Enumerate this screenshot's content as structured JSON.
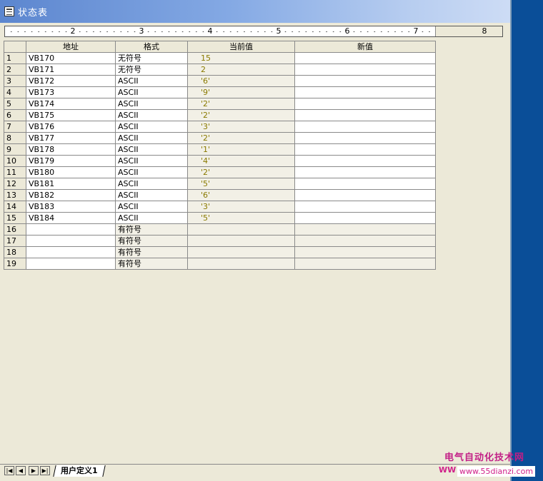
{
  "window": {
    "title": "状态表"
  },
  "ruler": {
    "labels": [
      "2",
      "3",
      "4",
      "5",
      "6",
      "7",
      "8"
    ]
  },
  "table": {
    "headers": {
      "address": "地址",
      "format": "格式",
      "current": "当前值",
      "new": "新值"
    },
    "rows": [
      {
        "num": "1",
        "address": "VB170",
        "format": "无符号",
        "current": "15"
      },
      {
        "num": "2",
        "address": "VB171",
        "format": "无符号",
        "current": "2"
      },
      {
        "num": "3",
        "address": "VB172",
        "format": "ASCII",
        "current": "'6'"
      },
      {
        "num": "4",
        "address": "VB173",
        "format": "ASCII",
        "current": "'9'"
      },
      {
        "num": "5",
        "address": "VB174",
        "format": "ASCII",
        "current": "'2'"
      },
      {
        "num": "6",
        "address": "VB175",
        "format": "ASCII",
        "current": "'2'"
      },
      {
        "num": "7",
        "address": "VB176",
        "format": "ASCII",
        "current": "'3'"
      },
      {
        "num": "8",
        "address": "VB177",
        "format": "ASCII",
        "current": "'2'"
      },
      {
        "num": "9",
        "address": "VB178",
        "format": "ASCII",
        "current": "'1'"
      },
      {
        "num": "10",
        "address": "VB179",
        "format": "ASCII",
        "current": "'4'"
      },
      {
        "num": "11",
        "address": "VB180",
        "format": "ASCII",
        "current": "'2'"
      },
      {
        "num": "12",
        "address": "VB181",
        "format": "ASCII",
        "current": "'5'"
      },
      {
        "num": "13",
        "address": "VB182",
        "format": "ASCII",
        "current": "'6'"
      },
      {
        "num": "14",
        "address": "VB183",
        "format": "ASCII",
        "current": "'3'"
      },
      {
        "num": "15",
        "address": "VB184",
        "format": "ASCII",
        "current": "'5'"
      },
      {
        "num": "16",
        "address": "",
        "format": "有符号",
        "current": ""
      },
      {
        "num": "17",
        "address": "",
        "format": "有符号",
        "current": ""
      },
      {
        "num": "18",
        "address": "",
        "format": "有符号",
        "current": ""
      },
      {
        "num": "19",
        "address": "",
        "format": "有符号",
        "current": ""
      }
    ]
  },
  "sheet_tab": {
    "label": "用户定义1"
  },
  "nav_buttons": [
    "|◀",
    "◀",
    "▶",
    "▶|"
  ],
  "watermark": {
    "cn": "电气自动化技术网",
    "url": "www.55dianzi.com",
    "prefix": "WW"
  },
  "colors": {
    "title_start": "#5c86cf",
    "current_value": "#8a7a00",
    "desktop": "#0a4e98"
  }
}
